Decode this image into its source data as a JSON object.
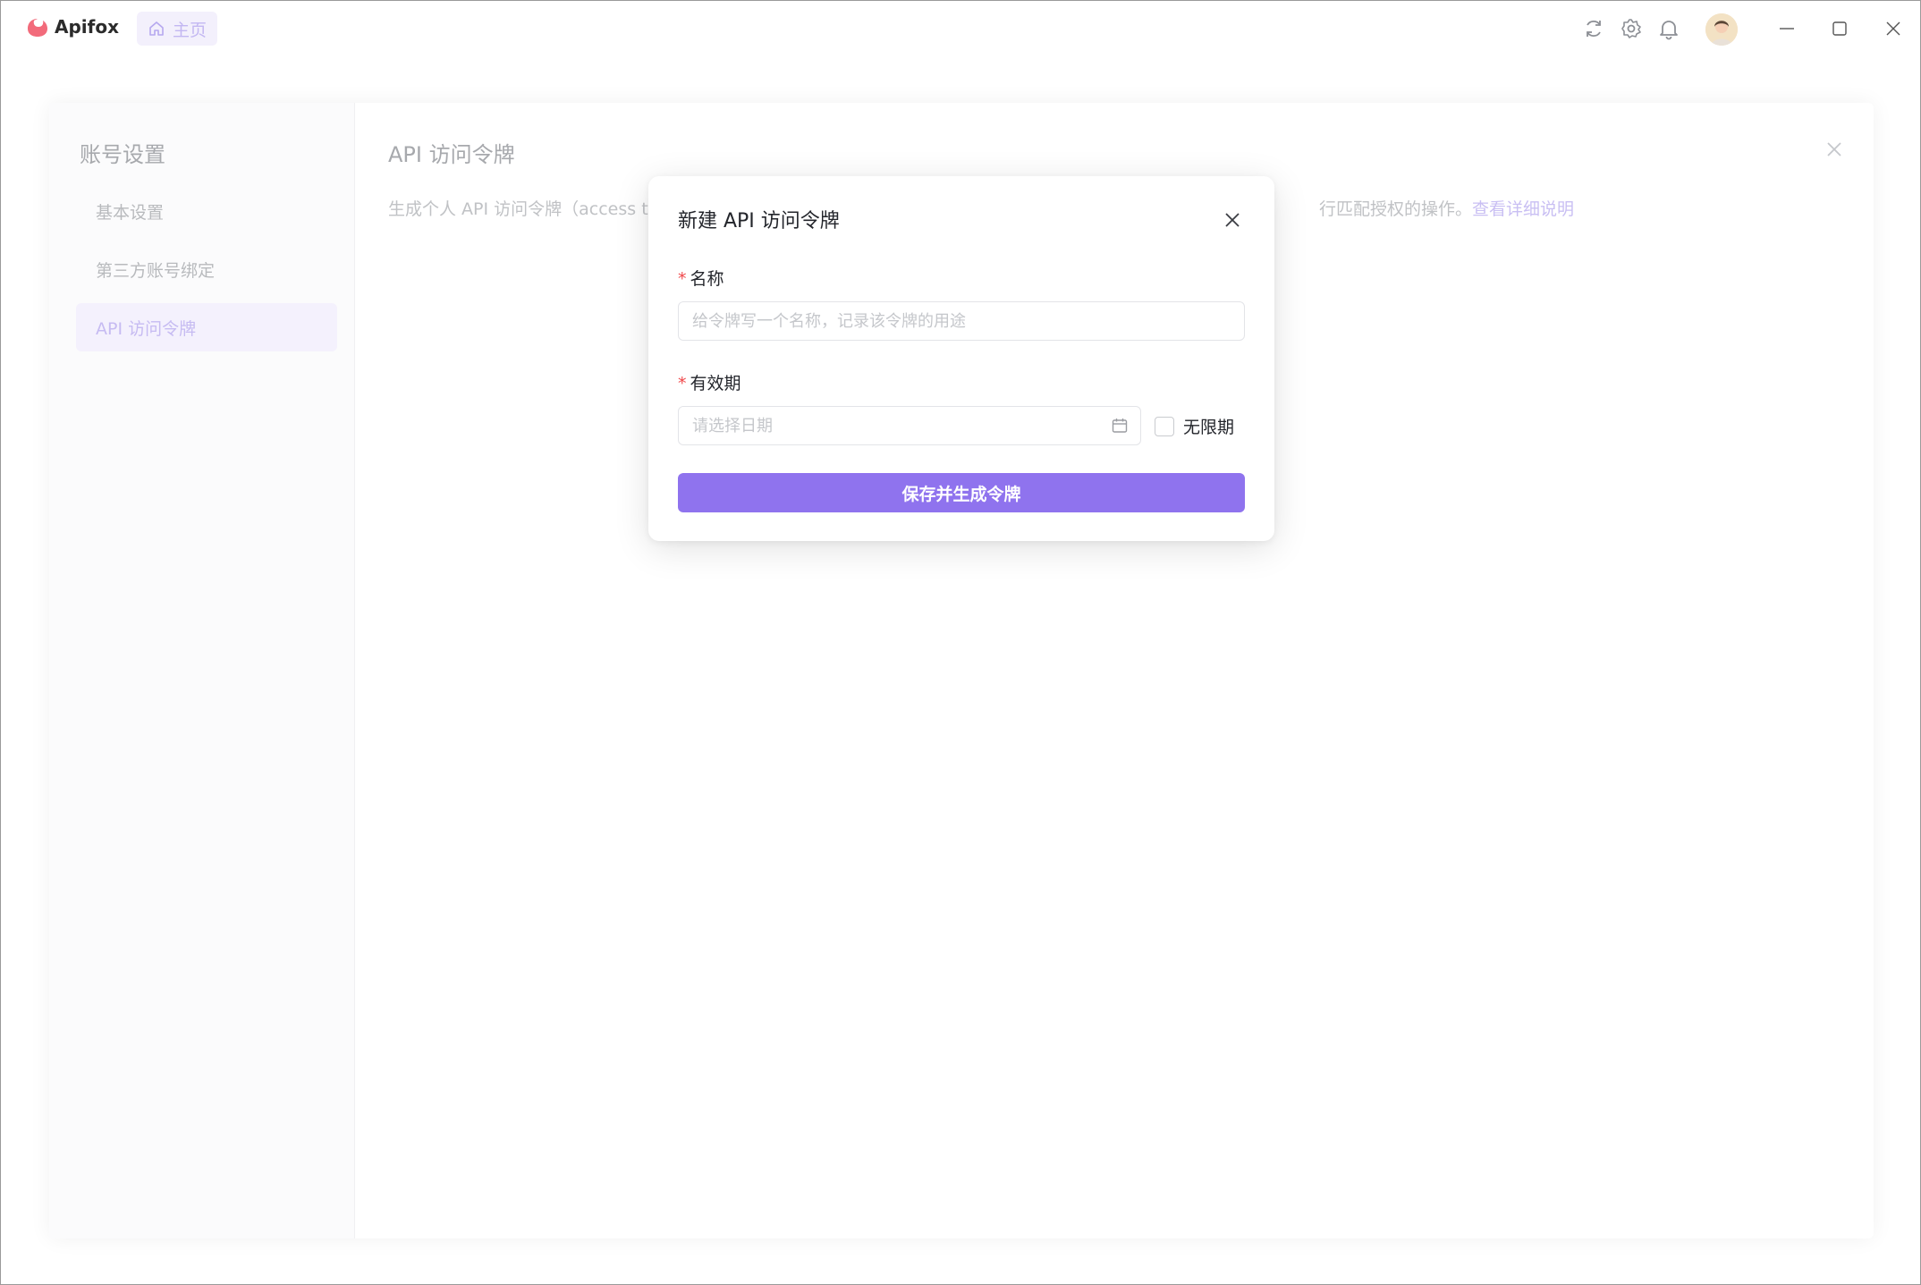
{
  "app": {
    "name": "Apifox",
    "brand_color": "#8f73ee"
  },
  "titlebar": {
    "home_tab_label": "主页",
    "icons": [
      "refresh-icon",
      "gear-icon",
      "bell-icon"
    ],
    "window_controls": [
      "minimize-icon",
      "maximize-icon",
      "close-icon"
    ]
  },
  "background_page": {
    "sidebar_title": "账号设置",
    "sidebar_items": [
      {
        "label": "基本设置",
        "active": false
      },
      {
        "label": "第三方账号绑定",
        "active": false
      },
      {
        "label": "API 访问令牌",
        "active": true
      }
    ],
    "main_title": "API 访问令牌",
    "description_left": "生成个人 API 访问令牌（access tok",
    "description_right": "行匹配授权的操作。",
    "detail_link": "查看详细说明"
  },
  "modal": {
    "title": "新建 API 访问令牌",
    "name_field": {
      "label": "名称",
      "required_mark": "*",
      "placeholder": "给令牌写一个名称，记录该令牌的用途",
      "value": ""
    },
    "expiry_field": {
      "label": "有效期",
      "required_mark": "*",
      "placeholder": "请选择日期",
      "value": ""
    },
    "no_expiry_checkbox": {
      "label": "无限期",
      "checked": false
    },
    "submit_label": "保存并生成令牌"
  }
}
